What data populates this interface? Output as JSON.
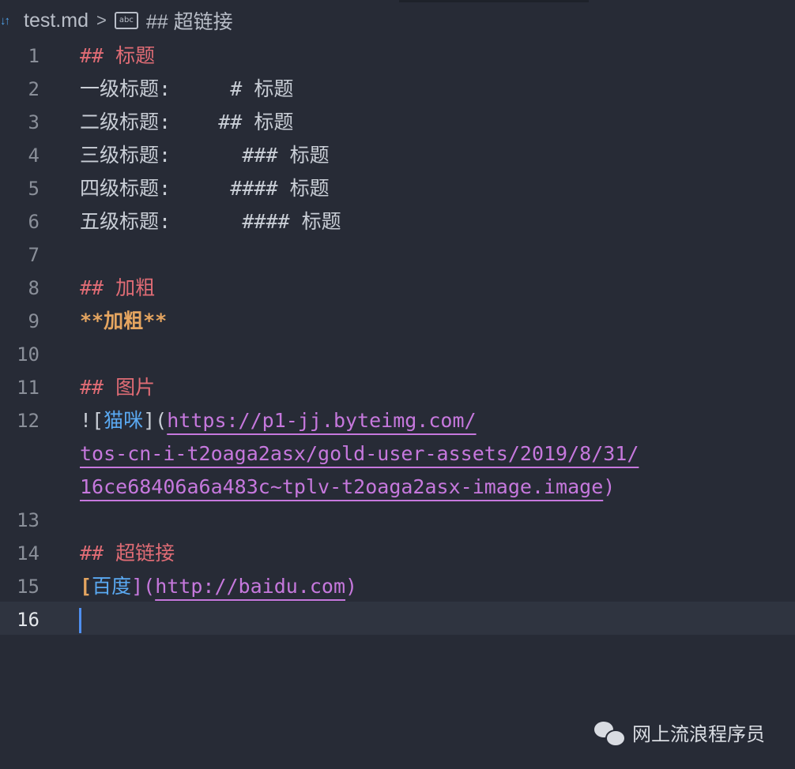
{
  "breadcrumb": {
    "file_icon": "markdown-icon",
    "file_icon_glyph": "↓↑",
    "filename": "test.md",
    "separator": ">",
    "symbol_icon": "abc-symbol-icon",
    "symbol_icon_text": "abc",
    "symbol": "## 超链接"
  },
  "lines": [
    {
      "num": "1",
      "parts": [
        {
          "t": "## 标题",
          "c": "h"
        }
      ]
    },
    {
      "num": "2",
      "parts": [
        {
          "t": "一级标题:     # 标题",
          "c": "punc"
        }
      ]
    },
    {
      "num": "3",
      "parts": [
        {
          "t": "二级标题:    ## 标题",
          "c": "punc"
        }
      ]
    },
    {
      "num": "4",
      "parts": [
        {
          "t": "三级标题:      ### 标题",
          "c": "punc"
        }
      ]
    },
    {
      "num": "5",
      "parts": [
        {
          "t": "四级标题:     #### 标题",
          "c": "punc"
        }
      ]
    },
    {
      "num": "6",
      "parts": [
        {
          "t": "五级标题:      #### 标题",
          "c": "punc"
        }
      ]
    },
    {
      "num": "7",
      "parts": []
    },
    {
      "num": "8",
      "parts": [
        {
          "t": "## 加粗",
          "c": "h"
        }
      ]
    },
    {
      "num": "9",
      "parts": [
        {
          "t": "**加粗**",
          "c": "bold"
        }
      ]
    },
    {
      "num": "10",
      "parts": []
    },
    {
      "num": "11",
      "parts": [
        {
          "t": "## 图片",
          "c": "h"
        }
      ]
    },
    {
      "num": "12",
      "parts": [
        {
          "t": "![",
          "c": "punc"
        },
        {
          "t": "猫咪",
          "c": "lt"
        },
        {
          "t": "](",
          "c": "punc"
        },
        {
          "t": "https://p1-jj.byteimg.com/",
          "c": "url"
        }
      ]
    },
    {
      "num": "",
      "parts": [
        {
          "t": "tos-cn-i-t2oaga2asx/gold-user-assets/2019/8/31/",
          "c": "url"
        }
      ]
    },
    {
      "num": "",
      "parts": [
        {
          "t": "16ce68406a6a483c~tplv-t2oaga2asx-image.image",
          "c": "url"
        },
        {
          "t": ")",
          "c": "br"
        }
      ]
    },
    {
      "num": "13",
      "parts": []
    },
    {
      "num": "14",
      "parts": [
        {
          "t": "## 超链接",
          "c": "h"
        }
      ]
    },
    {
      "num": "15",
      "parts": [
        {
          "t": "[",
          "c": "bold"
        },
        {
          "t": "百度",
          "c": "lt"
        },
        {
          "t": "](",
          "c": "br"
        },
        {
          "t": "http://baidu.com",
          "c": "url"
        },
        {
          "t": ")",
          "c": "br"
        }
      ]
    },
    {
      "num": "16",
      "parts": [],
      "active": true
    }
  ],
  "watermark": {
    "icon": "wechat-icon",
    "text": "网上流浪程序员"
  },
  "colors": {
    "background": "#272b36",
    "heading": "#e06c75",
    "bold": "#e5a560",
    "link_text": "#5aa9f2",
    "url": "#c678dd",
    "cursor": "#4f8ff0"
  }
}
